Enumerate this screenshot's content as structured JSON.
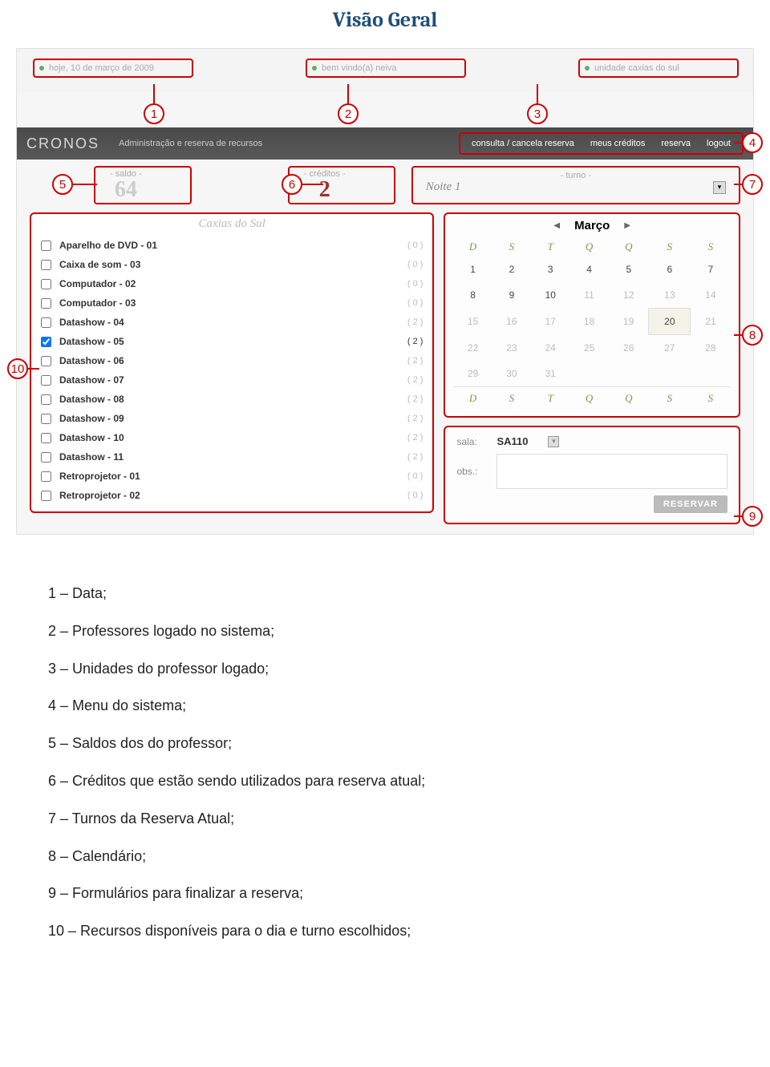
{
  "page_title": "Visão Geral",
  "topbar": {
    "date": "hoje, 10 de março de 2009",
    "welcome": "bem vindo(a) neiva",
    "unit": "unidade caxias do sul"
  },
  "navbar": {
    "brand": "CRONOS",
    "subtitle": "Administração e reserva de recursos",
    "links": [
      "consulta / cancela reserva",
      "meus créditos",
      "reserva",
      "logout"
    ]
  },
  "stats": {
    "saldo_label": "- saldo -",
    "saldo_value": "64",
    "creditos_label": "- créditos -",
    "creditos_value": "2",
    "turno_label": "- turno -",
    "turno_value": "Noite 1"
  },
  "resources": {
    "title": "Caxias do Sul",
    "items": [
      {
        "name": "Aparelho de DVD - 01",
        "count": "( 0 )",
        "checked": false,
        "dim": true
      },
      {
        "name": "Caixa de som - 03",
        "count": "( 0 )",
        "checked": false,
        "dim": true
      },
      {
        "name": "Computador - 02",
        "count": "( 0 )",
        "checked": false,
        "dim": true
      },
      {
        "name": "Computador - 03",
        "count": "( 0 )",
        "checked": false,
        "dim": true
      },
      {
        "name": "Datashow - 04",
        "count": "( 2 )",
        "checked": false,
        "dim": true
      },
      {
        "name": "Datashow - 05",
        "count": "( 2 )",
        "checked": true,
        "dim": false
      },
      {
        "name": "Datashow - 06",
        "count": "( 2 )",
        "checked": false,
        "dim": true
      },
      {
        "name": "Datashow - 07",
        "count": "( 2 )",
        "checked": false,
        "dim": true
      },
      {
        "name": "Datashow - 08",
        "count": "( 2 )",
        "checked": false,
        "dim": true
      },
      {
        "name": "Datashow - 09",
        "count": "( 2 )",
        "checked": false,
        "dim": true
      },
      {
        "name": "Datashow - 10",
        "count": "( 2 )",
        "checked": false,
        "dim": true
      },
      {
        "name": "Datashow - 11",
        "count": "( 2 )",
        "checked": false,
        "dim": true
      },
      {
        "name": "Retroprojetor - 01",
        "count": "( 0 )",
        "checked": false,
        "dim": true
      },
      {
        "name": "Retroprojetor - 02",
        "count": "( 0 )",
        "checked": false,
        "dim": true
      }
    ]
  },
  "calendar": {
    "month": "Março",
    "dow": [
      "D",
      "S",
      "T",
      "Q",
      "Q",
      "S",
      "S"
    ],
    "weeks": [
      [
        "1",
        "2",
        "3",
        "4",
        "5",
        "6",
        "7"
      ],
      [
        "8",
        "9",
        "10",
        "11",
        "12",
        "13",
        "14"
      ],
      [
        "15",
        "16",
        "17",
        "18",
        "19",
        "20",
        "21"
      ],
      [
        "22",
        "23",
        "24",
        "25",
        "26",
        "27",
        "28"
      ],
      [
        "29",
        "30",
        "31",
        "",
        "",
        "",
        ""
      ]
    ],
    "dim_from_index": 10,
    "today_index": 19
  },
  "form": {
    "sala_label": "sala:",
    "sala_value": "SA110",
    "obs_label": "obs.:",
    "button": "RESERVAR"
  },
  "callouts": [
    "1",
    "2",
    "3",
    "4",
    "5",
    "6",
    "7",
    "8",
    "9",
    "10"
  ],
  "legend": [
    "1 – Data;",
    "2 – Professores logado no sistema;",
    "3 – Unidades do professor logado;",
    "4 – Menu do sistema;",
    "5 – Saldos dos do professor;",
    "6 – Créditos que estão sendo utilizados para reserva atual;",
    "7 – Turnos da Reserva Atual;",
    "8 – Calendário;",
    "9 – Formulários para finalizar a reserva;",
    "10 – Recursos disponíveis para o dia e turno escolhidos;"
  ]
}
